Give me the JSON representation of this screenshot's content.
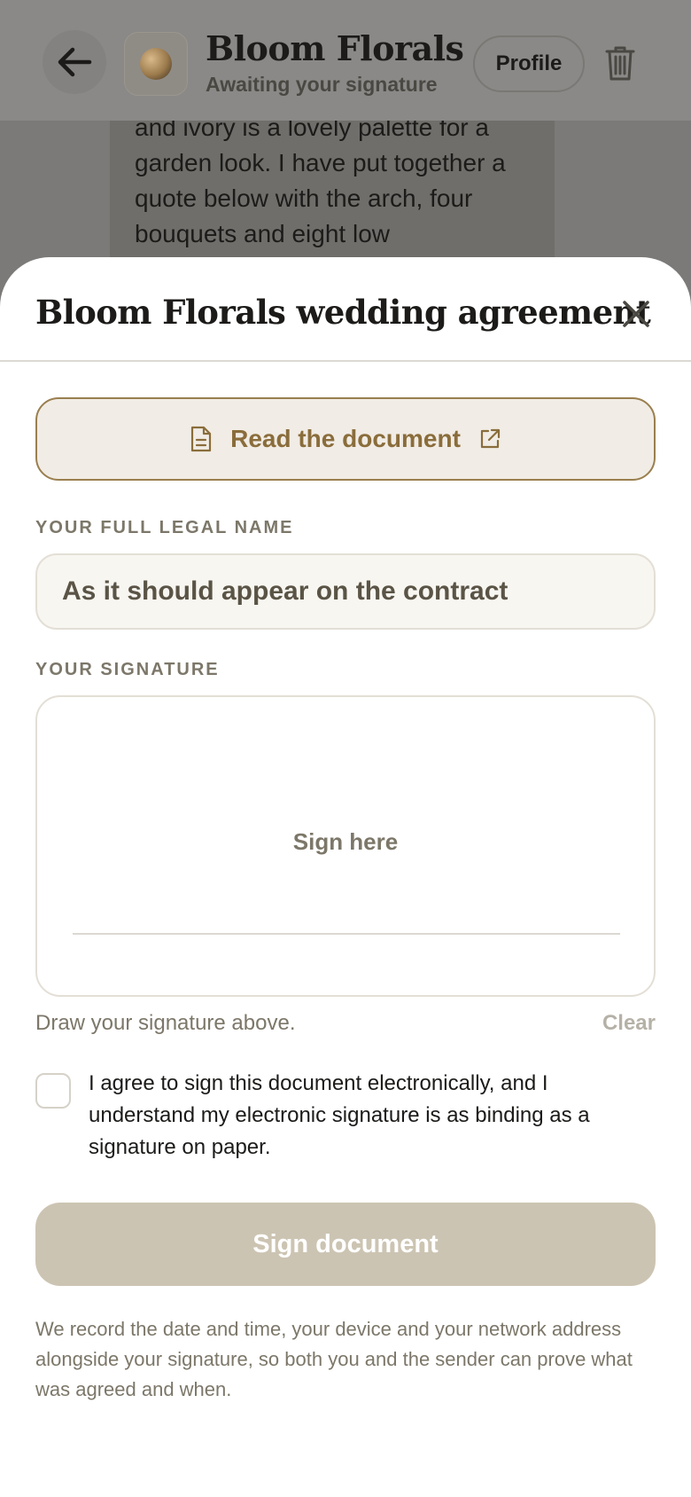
{
  "header": {
    "title": "Bloom Florals",
    "subtitle": "Awaiting your signature",
    "profile_label": "Profile"
  },
  "background_message": {
    "text": "and ivory is a lovely palette for a garden look. I have put together a quote below with the arch, four bouquets and eight low"
  },
  "sheet": {
    "title": "Bloom Florals wedding agreement",
    "read_button_label": "Read the document",
    "name_label": "YOUR FULL LEGAL NAME",
    "name_placeholder": "As it should appear on the contract",
    "name_value": "",
    "signature_label": "YOUR SIGNATURE",
    "signature_placeholder": "Sign here",
    "signature_hint": "Draw your signature above.",
    "clear_label": "Clear",
    "consent_checked": false,
    "consent_text": "I agree to sign this document electronically, and I understand my electronic signature is as binding as a signature on paper.",
    "sign_button_label": "Sign document",
    "legal_note": "We record the date and time, your device and your network address alongside your signature, so both you and the sender can prove what was agreed and when."
  },
  "icons": {
    "back": "arrow-left-icon",
    "delete": "trash-icon",
    "close": "close-icon",
    "document": "document-icon",
    "external": "external-link-icon"
  },
  "colors": {
    "accent": "#8a6d3b",
    "accent_border": "#9a7f4f",
    "disabled_button": "#ccc4b2",
    "overlay": "#7b7a78"
  }
}
